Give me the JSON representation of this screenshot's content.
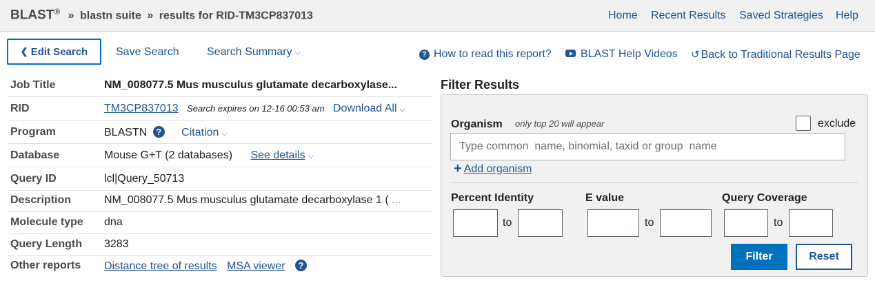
{
  "header": {
    "brand": "BLAST",
    "brand_sup": "®",
    "sep": "»",
    "crumb_suite": "blastn suite",
    "crumb_results": "results for RID-TM3CP837013",
    "nav": {
      "home": "Home",
      "recent": "Recent Results",
      "saved": "Saved Strategies",
      "help": "Help"
    }
  },
  "toolbar": {
    "edit_search": "Edit Search",
    "save_search": "Save Search",
    "search_summary": "Search Summary",
    "how_to_read": "How to read this report?",
    "help_videos": "BLAST Help Videos",
    "back_traditional": "Back to Traditional Results Page"
  },
  "job": {
    "labels": {
      "job_title": "Job Title",
      "rid": "RID",
      "program": "Program",
      "database": "Database",
      "query_id": "Query ID",
      "description": "Description",
      "molecule_type": "Molecule type",
      "query_length": "Query Length",
      "other_reports": "Other reports"
    },
    "job_title": "NM_008077.5 Mus musculus glutamate decarboxylase...",
    "rid": "TM3CP837013",
    "expires": "Search expires on 12-16 00:53 am",
    "download_all": "Download All",
    "program": "BLASTN",
    "citation": "Citation",
    "database": "Mouse G+T (2 databases)",
    "see_details": "See details",
    "query_id": "lcl|Query_50713",
    "description": "NM_008077.5 Mus musculus glutamate decarboxylase 1 (",
    "description_more": "...",
    "molecule_type": "dna",
    "query_length": "3283",
    "distance_tree": "Distance tree of results",
    "msa_viewer": "MSA viewer"
  },
  "filter": {
    "title": "Filter Results",
    "organism_label": "Organism",
    "organism_hint": "only top 20 will appear",
    "exclude_label": "exclude",
    "organism_placeholder": "Type common  name, binomial, taxid or group  name",
    "add_organism": "Add organism",
    "percent_identity": "Percent Identity",
    "e_value": "E value",
    "query_coverage": "Query Coverage",
    "to": "to",
    "filter_btn": "Filter",
    "reset_btn": "Reset"
  },
  "colors": {
    "link": "#205493",
    "primary_button": "#0071bc",
    "header_bg": "#f1f1f1",
    "panel_bg": "#f1f1f1"
  }
}
